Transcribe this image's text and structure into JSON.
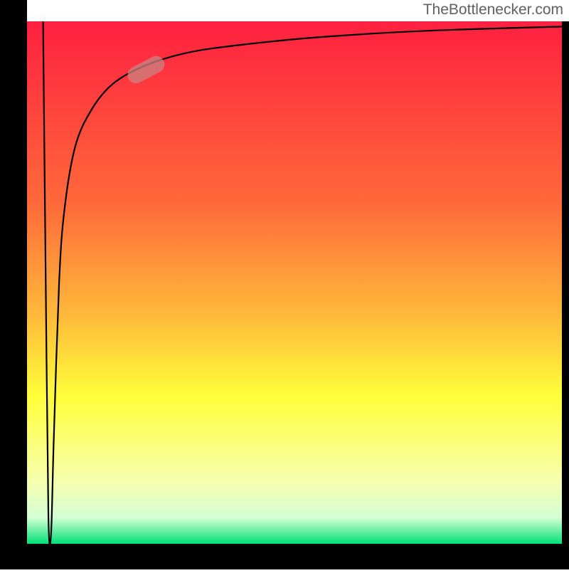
{
  "watermark": "TheBottlenecker.com",
  "chart_data": {
    "type": "line",
    "title": "",
    "xlabel": "",
    "ylabel": "",
    "xlim": [
      0,
      100
    ],
    "ylim": [
      0,
      100
    ],
    "plot_background_gradient": {
      "type": "vertical",
      "stops": [
        {
          "pos": 0.0,
          "color": "#ff2040"
        },
        {
          "pos": 0.35,
          "color": "#ff6a3a"
        },
        {
          "pos": 0.55,
          "color": "#ffb43a"
        },
        {
          "pos": 0.72,
          "color": "#ffff3a"
        },
        {
          "pos": 0.88,
          "color": "#f6ffae"
        },
        {
          "pos": 0.95,
          "color": "#d4ffd4"
        },
        {
          "pos": 1.0,
          "color": "#00e077"
        }
      ]
    },
    "frame_color": "#000000",
    "frame_left_margin": 38,
    "frame_right_margin": 10,
    "frame_top_margin": 30,
    "frame_bottom_margin": 36,
    "series": [
      {
        "name": "curve",
        "color": "#000000",
        "comment": "Approximate curve: a sharp drop from the top-left to the bottom, then a steep rise toward the top-right, asymptotically approaching the top.",
        "points": [
          {
            "x": 3.0,
            "y": 100.0
          },
          {
            "x": 3.5,
            "y": 50.0
          },
          {
            "x": 4.0,
            "y": 5.0
          },
          {
            "x": 4.5,
            "y": 2.0
          },
          {
            "x": 5.0,
            "y": 20.0
          },
          {
            "x": 6.0,
            "y": 50.0
          },
          {
            "x": 7.0,
            "y": 64.0
          },
          {
            "x": 9.0,
            "y": 76.0
          },
          {
            "x": 12.0,
            "y": 83.0
          },
          {
            "x": 16.0,
            "y": 88.0
          },
          {
            "x": 22.0,
            "y": 91.5
          },
          {
            "x": 30.0,
            "y": 94.0
          },
          {
            "x": 40.0,
            "y": 95.5
          },
          {
            "x": 55.0,
            "y": 97.0
          },
          {
            "x": 75.0,
            "y": 98.2
          },
          {
            "x": 100.0,
            "y": 99.0
          }
        ]
      }
    ],
    "highlight_segment": {
      "color": "#c98383",
      "opacity": 0.75,
      "x1": 19.0,
      "y1": 89.0,
      "x2": 25.5,
      "y2": 92.5,
      "thickness_data_units": 3.2
    }
  }
}
